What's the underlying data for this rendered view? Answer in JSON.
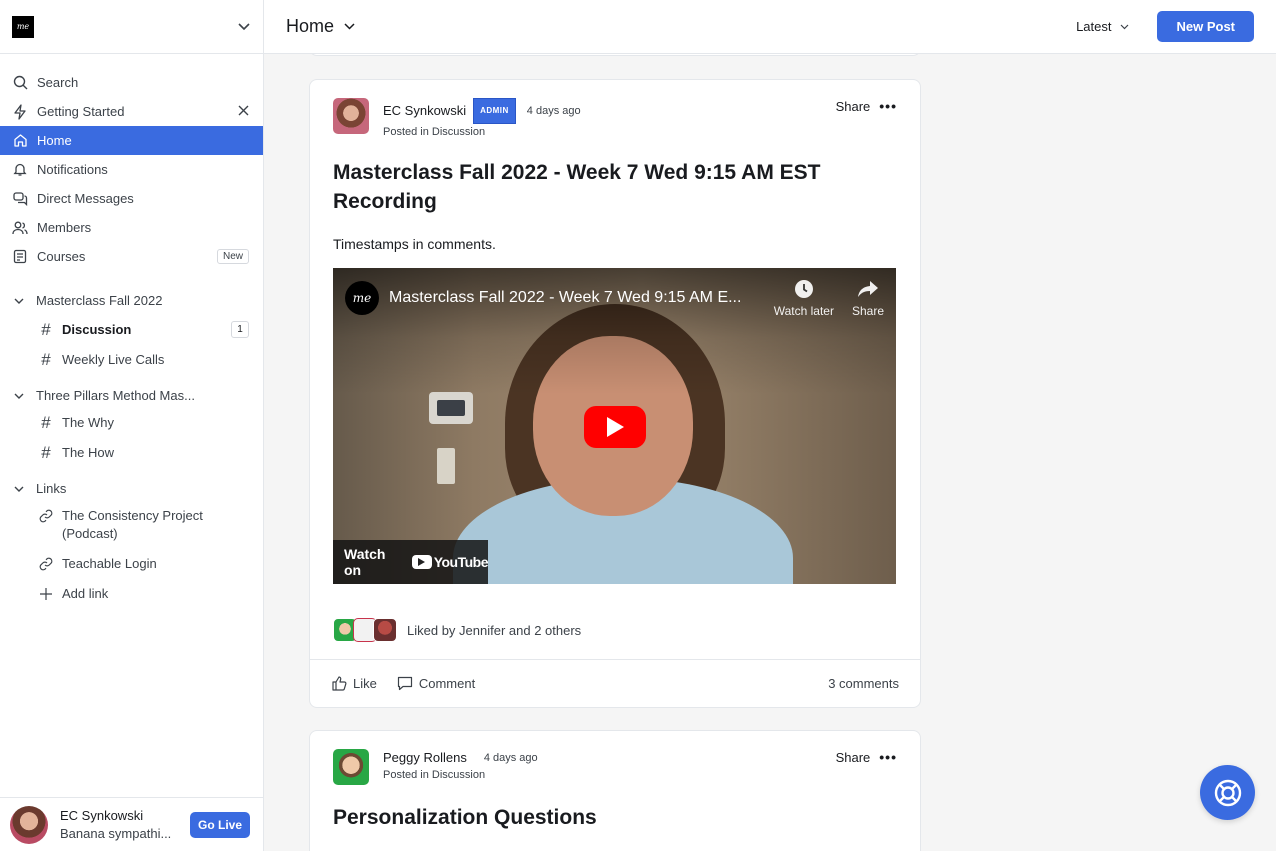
{
  "brand": {
    "logo_text": "me"
  },
  "sidebar": {
    "items": [
      {
        "label": "Search",
        "icon": "search-icon"
      },
      {
        "label": "Getting Started",
        "icon": "lightning-icon"
      },
      {
        "label": "Home",
        "icon": "home-icon"
      },
      {
        "label": "Notifications",
        "icon": "bell-icon"
      },
      {
        "label": "Direct Messages",
        "icon": "messages-icon"
      },
      {
        "label": "Members",
        "icon": "members-icon"
      },
      {
        "label": "Courses",
        "icon": "courses-icon",
        "badge": "New"
      }
    ],
    "sections": [
      {
        "title": "Masterclass Fall 2022",
        "items": [
          {
            "label": "Discussion",
            "count": "1"
          },
          {
            "label": "Weekly Live Calls"
          }
        ]
      },
      {
        "title": "Three Pillars Method Mas...",
        "items": [
          {
            "label": "The Why"
          },
          {
            "label": "The How"
          }
        ]
      },
      {
        "title": "Links",
        "items": [
          {
            "label": "The Consistency Project (Podcast)"
          },
          {
            "label": "Teachable Login"
          },
          {
            "label": "Add link"
          }
        ]
      }
    ],
    "user": {
      "name": "EC Synkowski",
      "status": "Banana sympathi...",
      "golive": "Go Live"
    }
  },
  "header": {
    "title": "Home",
    "sort": "Latest",
    "new_post": "New Post"
  },
  "posts": [
    {
      "author": "EC Synkowski",
      "role": "ADMIN",
      "time": "4 days ago",
      "posted_in": "Posted in Discussion",
      "share": "Share",
      "title": "Masterclass Fall 2022 - Week 7 Wed 9:15 AM EST Recording",
      "body": "Timestamps in comments.",
      "video": {
        "channel_logo": "me",
        "title": "Masterclass Fall 2022 - Week 7 Wed 9:15 AM E...",
        "watch_later": "Watch later",
        "share": "Share",
        "watch_on": "Watch on",
        "youtube": "YouTube"
      },
      "liked_by": "Liked by Jennifer and 2 others",
      "like": "Like",
      "comment": "Comment",
      "comments_count": "3 comments"
    },
    {
      "author": "Peggy Rollens",
      "time": "4 days ago",
      "posted_in": "Posted in Discussion",
      "share": "Share",
      "title": "Personalization Questions"
    }
  ],
  "colors": {
    "accent": "#3a6be0",
    "youtube_red": "#ff0000"
  }
}
